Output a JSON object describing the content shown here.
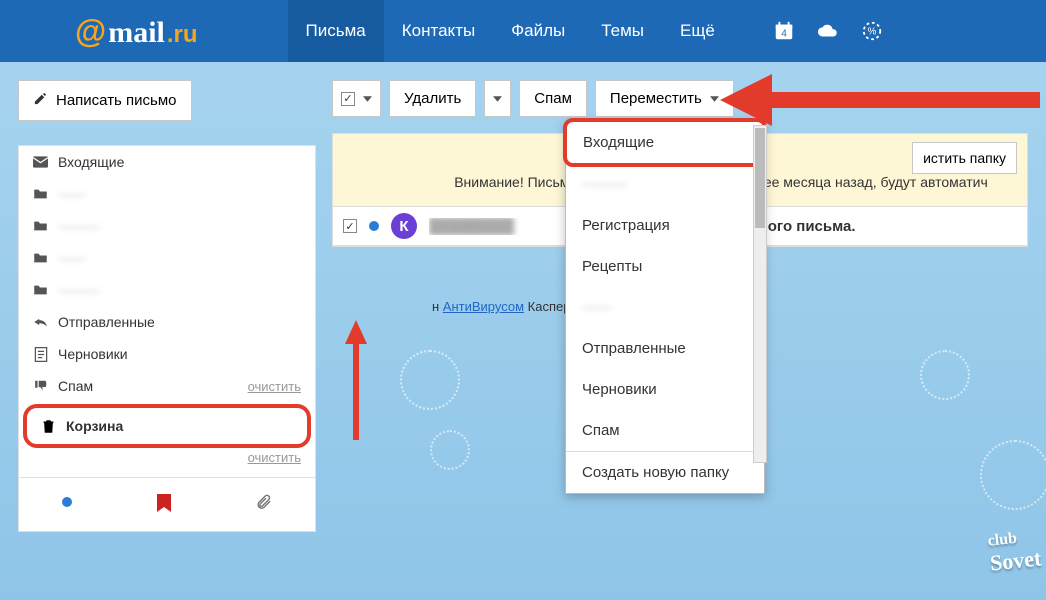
{
  "header": {
    "logo": {
      "at": "@",
      "mail": "mail",
      "dot": ".ru"
    },
    "nav": [
      "Письма",
      "Контакты",
      "Файлы",
      "Темы",
      "Ещё"
    ],
    "active_nav_index": 0,
    "calendar_badge": "4"
  },
  "compose": {
    "label": "Написать письмо"
  },
  "sidebar": {
    "folders": [
      {
        "icon": "inbox",
        "label": "Входящие"
      },
      {
        "icon": "folder",
        "label": "——",
        "blurred": true
      },
      {
        "icon": "folder",
        "label": "———",
        "blurred": true
      },
      {
        "icon": "folder",
        "label": "——",
        "blurred": true
      },
      {
        "icon": "folder",
        "label": "———",
        "blurred": true
      },
      {
        "icon": "sent",
        "label": "Отправленные"
      },
      {
        "icon": "drafts",
        "label": "Черновики"
      },
      {
        "icon": "spam",
        "label": "Спам",
        "clear": "очистить"
      }
    ],
    "trash": {
      "label": "Корзина",
      "clear": "очистить"
    }
  },
  "toolbar": {
    "delete": "Удалить",
    "spam": "Спам",
    "move": "Переместить"
  },
  "dropdown": {
    "selected": "Входящие",
    "items": [
      "———",
      "Регистрация",
      "Рецепты",
      "——",
      "Отправленные",
      "Черновики",
      "Спам"
    ],
    "item_blurred": [
      true,
      false,
      false,
      true,
      false,
      false,
      false
    ],
    "create": "Создать новую папку"
  },
  "notice": {
    "empty_button": "истить папку",
    "warning": "Внимание! Письма, помещённые в корзину более месяца назад, будут автоматич"
  },
  "mail": {
    "avatar_letter": "К",
    "subject_tail": "даленного письма."
  },
  "av": {
    "prefix": "н ",
    "link": "АнтиВирусом",
    "tail": " Касперского"
  },
  "watermark": {
    "top": "club",
    "bottom": "Sovet"
  }
}
